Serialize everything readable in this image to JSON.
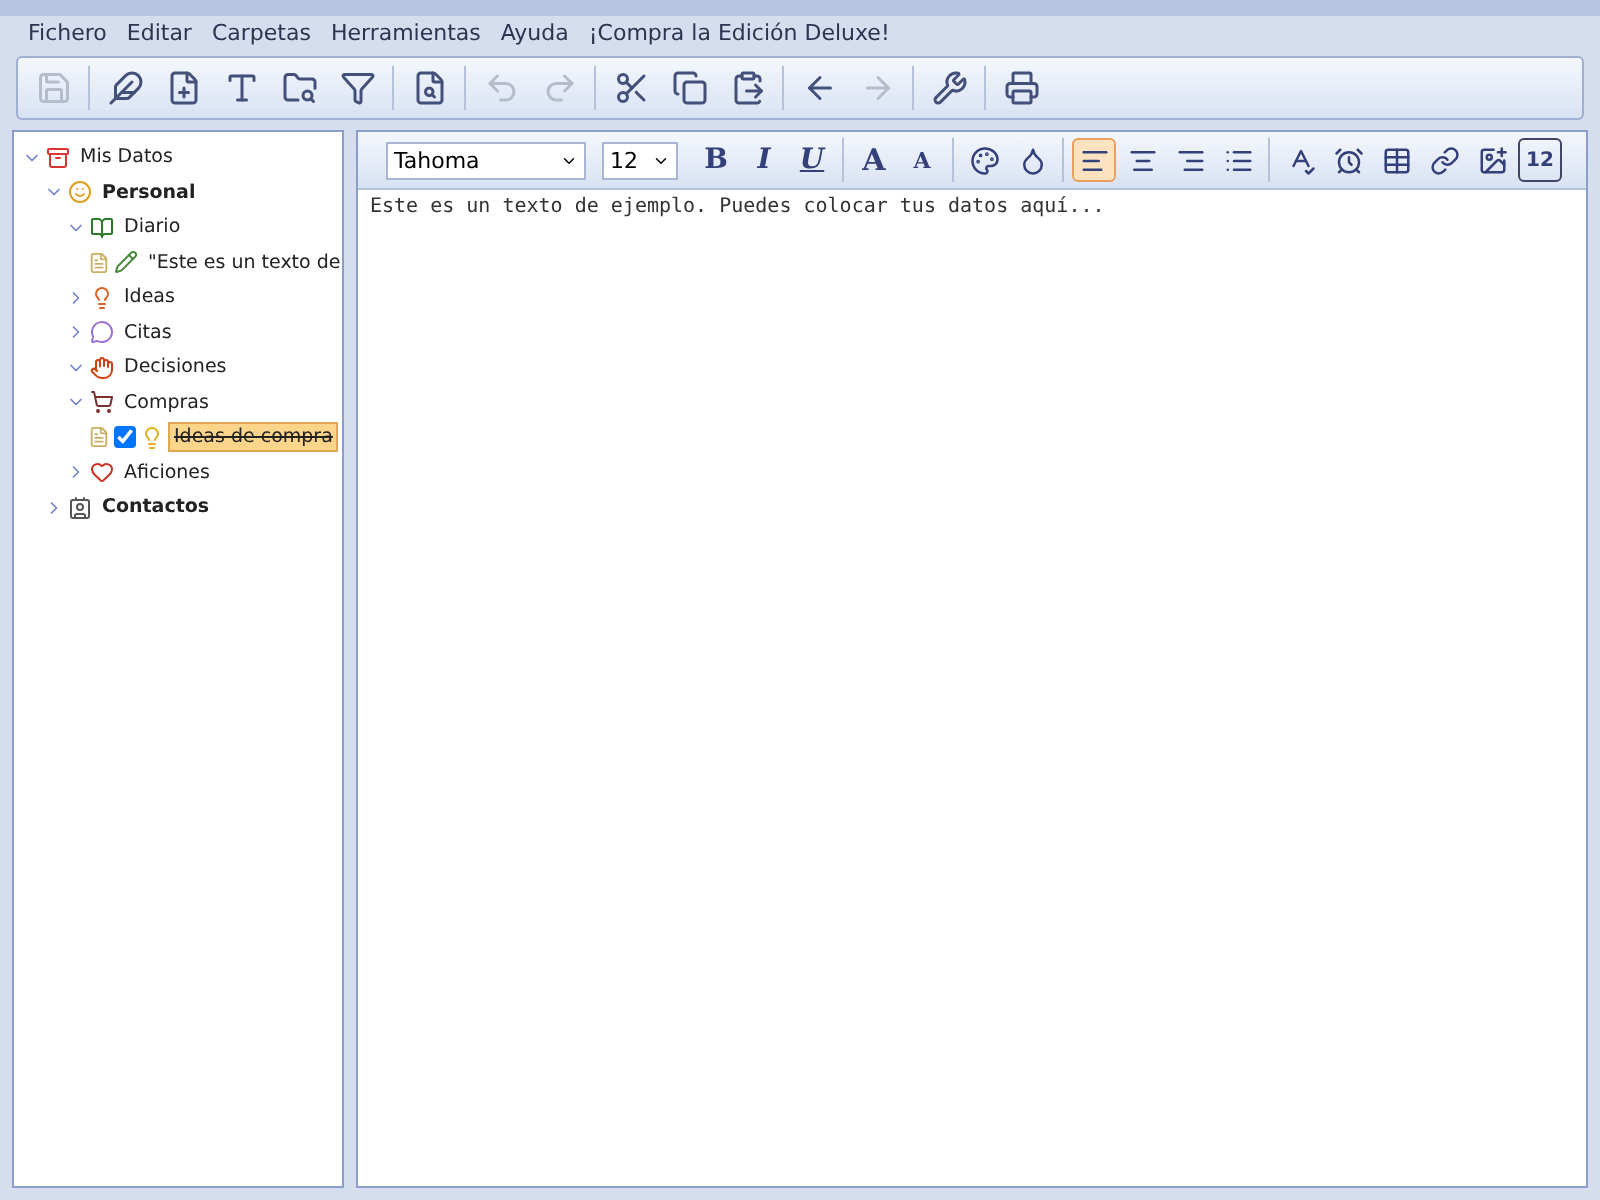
{
  "menu": [
    "Fichero",
    "Editar",
    "Carpetas",
    "Herramientas",
    "Ayuda",
    "¡Compra la Edición Deluxe!"
  ],
  "toolbar": [
    {
      "kind": "button",
      "disabled": true
    },
    {
      "kind": "separator"
    },
    {
      "kind": "button",
      "disabled": false
    },
    {
      "kind": "button",
      "disabled": false
    },
    {
      "kind": "button",
      "disabled": false
    },
    {
      "kind": "button",
      "disabled": false
    },
    {
      "kind": "button",
      "disabled": false
    },
    {
      "kind": "separator"
    },
    {
      "kind": "button",
      "disabled": false
    },
    {
      "kind": "separator"
    },
    {
      "kind": "button",
      "disabled": true
    },
    {
      "kind": "button",
      "disabled": true
    },
    {
      "kind": "separator"
    },
    {
      "kind": "button",
      "disabled": false
    },
    {
      "kind": "button",
      "disabled": false
    },
    {
      "kind": "button",
      "disabled": false
    },
    {
      "kind": "separator"
    },
    {
      "kind": "button",
      "disabled": false
    },
    {
      "kind": "button",
      "disabled": true
    },
    {
      "kind": "separator"
    },
    {
      "kind": "button",
      "disabled": false
    },
    {
      "kind": "separator"
    },
    {
      "kind": "button",
      "disabled": false
    }
  ],
  "tree": [
    {
      "label": "Mis Datos",
      "kind": "root",
      "bold": false,
      "expanded": true,
      "selected": false,
      "children": [
        {
          "label": "Personal",
          "kind": "smile",
          "bold": true,
          "expanded": true,
          "selected": false,
          "children": [
            {
              "label": "Diario",
              "kind": "book",
              "bold": false,
              "expanded": true,
              "selected": false,
              "children": [
                {
                  "label": "\"Este es un texto de",
                  "kind": "note",
                  "bold": false,
                  "selected": false
                }
              ]
            },
            {
              "label": "Ideas",
              "kind": "ideas",
              "bold": false,
              "expanded": false,
              "selected": false
            },
            {
              "label": "Citas",
              "kind": "quote",
              "bold": false,
              "expanded": false,
              "selected": false
            },
            {
              "label": "Decisiones",
              "kind": "decision",
              "bold": false,
              "expanded": true,
              "selected": false
            },
            {
              "label": "Compras",
              "kind": "cart",
              "bold": false,
              "expanded": true,
              "selected": false,
              "children": [
                {
                  "label": "Ideas de compra",
                  "kind": "task",
                  "bold": false,
                  "checked": true,
                  "selected": true
                }
              ]
            },
            {
              "label": "Aficiones",
              "kind": "heart",
              "bold": false,
              "expanded": false,
              "selected": false
            }
          ]
        },
        {
          "label": "Contactos",
          "kind": "contacts",
          "bold": true,
          "expanded": false,
          "selected": false
        }
      ]
    }
  ],
  "format": {
    "font": "Tahoma",
    "size": "12",
    "buttons": [
      {
        "kind": "text",
        "text": "B",
        "selected": false
      },
      {
        "kind": "text",
        "text": "I",
        "selected": false
      },
      {
        "kind": "text",
        "text": "U",
        "selected": false
      },
      {
        "kind": "separator"
      },
      {
        "kind": "text",
        "text": "A",
        "selected": false
      },
      {
        "kind": "text",
        "text": "A",
        "selected": false
      },
      {
        "kind": "separator"
      },
      {
        "kind": "icon",
        "selected": false
      },
      {
        "kind": "icon",
        "selected": false
      },
      {
        "kind": "separator"
      },
      {
        "kind": "icon",
        "selected": true
      },
      {
        "kind": "icon",
        "selected": false
      },
      {
        "kind": "icon",
        "selected": false
      },
      {
        "kind": "icon",
        "selected": false
      },
      {
        "kind": "separator"
      },
      {
        "kind": "icon",
        "selected": false
      },
      {
        "kind": "icon",
        "selected": false
      },
      {
        "kind": "icon",
        "selected": false
      },
      {
        "kind": "icon",
        "selected": false
      },
      {
        "kind": "icon",
        "selected": false
      },
      {
        "kind": "text",
        "text": "12",
        "selected": false
      }
    ]
  },
  "editor": {
    "text": "Este es un texto de ejemplo. Puedes colocar tus datos aquí..."
  }
}
